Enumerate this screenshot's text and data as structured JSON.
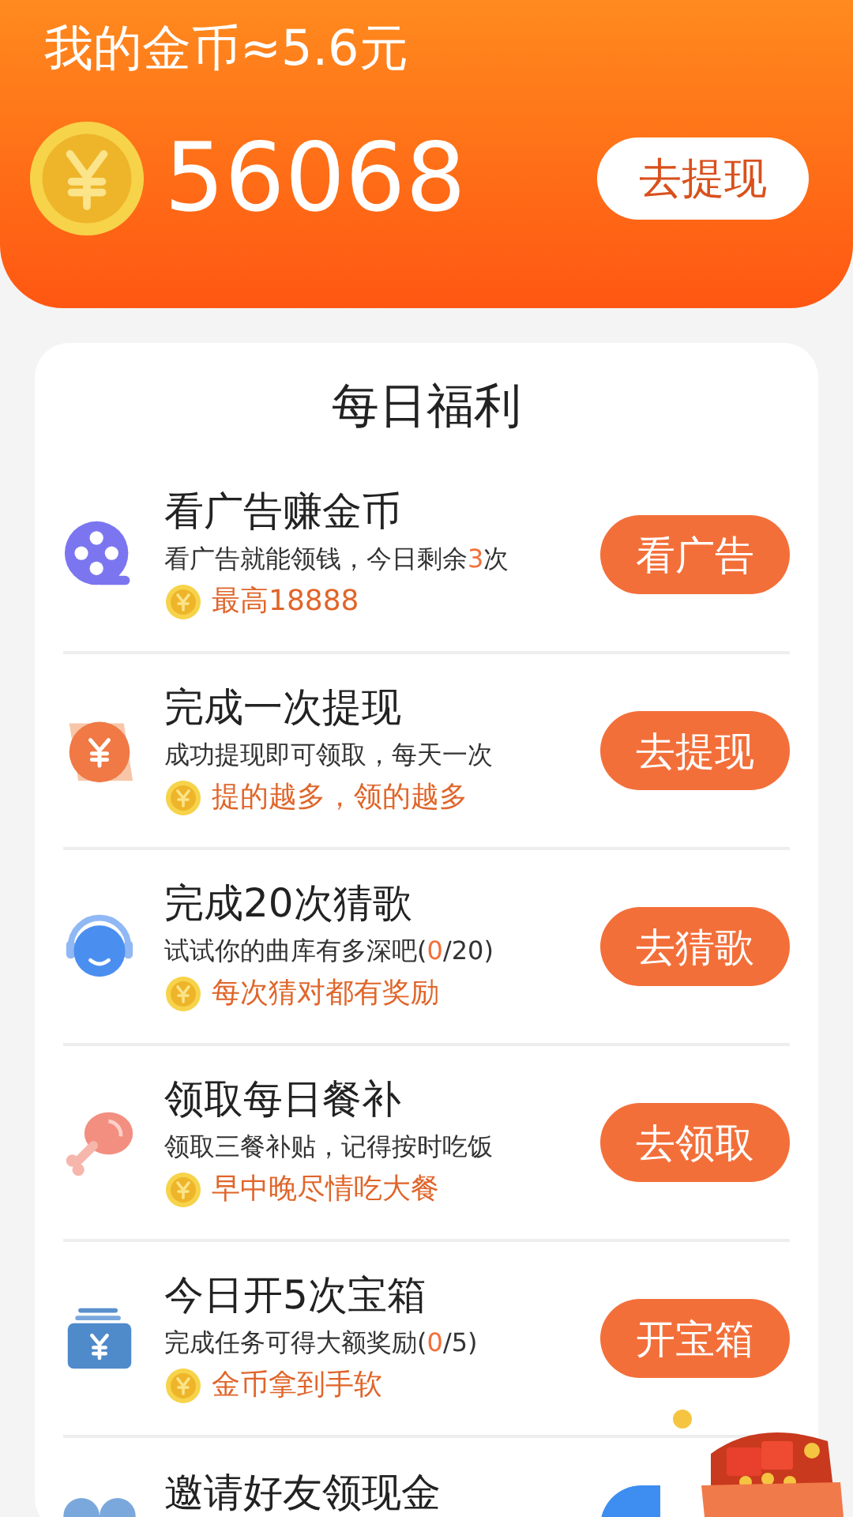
{
  "header": {
    "title": "我的金币≈5.6元",
    "balance": "56068",
    "withdraw_button": "去提现"
  },
  "daily": {
    "title": "每日福利",
    "tasks": [
      {
        "kind": "film",
        "title": "看广告赚金币",
        "subtitle": [
          {
            "text": "看广告就能领钱，今日剩余",
            "highlight": false
          },
          {
            "text": "3",
            "highlight": true
          },
          {
            "text": "次",
            "highlight": false
          }
        ],
        "reward": "最高18888",
        "button": "看广告",
        "color": "#f36f3a"
      },
      {
        "kind": "yen-coin",
        "title": "完成一次提现",
        "subtitle": [
          {
            "text": "成功提现即可领取，每天一次",
            "highlight": false
          }
        ],
        "reward": "提的越多，领的越多",
        "button": "去提现",
        "color": "#f36f3a"
      },
      {
        "kind": "headset",
        "title": "完成20次猜歌",
        "subtitle": [
          {
            "text": "试试你的曲库有多深吧(",
            "highlight": false
          },
          {
            "text": "0",
            "highlight": true
          },
          {
            "text": "/20)",
            "highlight": false
          }
        ],
        "reward": "每次猜对都有奖励",
        "button": "去猜歌",
        "color": "#f36f3a"
      },
      {
        "kind": "drumstick",
        "title": "领取每日餐补",
        "subtitle": [
          {
            "text": "领取三餐补贴，记得按时吃饭",
            "highlight": false
          }
        ],
        "reward": "早中晚尽情吃大餐",
        "button": "去领取",
        "color": "#f36f3a"
      },
      {
        "kind": "wallet",
        "title": "今日开5次宝箱",
        "subtitle": [
          {
            "text": "完成任务可得大额奖励(",
            "highlight": false
          },
          {
            "text": "0",
            "highlight": true
          },
          {
            "text": "/5)",
            "highlight": false
          }
        ],
        "reward": "金币拿到手软",
        "button": "开宝箱",
        "color": "#f36f3a"
      },
      {
        "kind": "people",
        "title": "邀请好友领现金",
        "color": "#3d8ef0"
      }
    ]
  }
}
